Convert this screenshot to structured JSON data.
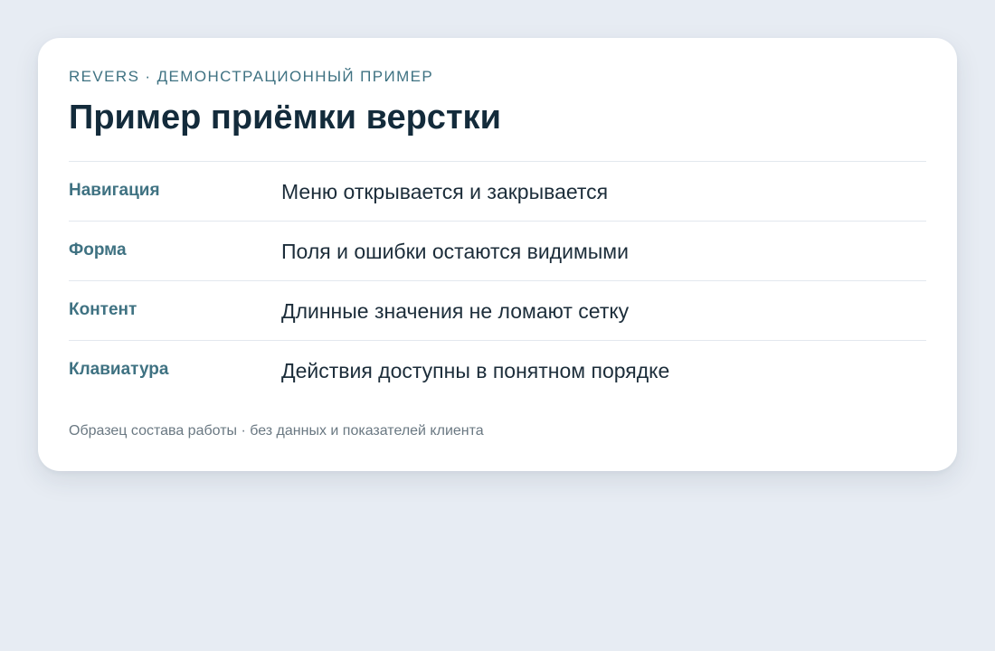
{
  "card": {
    "eyebrow": "REVERS · ДЕМОНСТРАЦИОННЫЙ ПРИМЕР",
    "title": "Пример приёмки верстки",
    "rows": [
      {
        "label": "Навигация",
        "value": "Меню открывается и закрывается"
      },
      {
        "label": "Форма",
        "value": "Поля и ошибки остаются видимыми"
      },
      {
        "label": "Контент",
        "value": "Длинные значения не ломают сетку"
      },
      {
        "label": "Клавиатура",
        "value": "Действия доступны в понятном порядке"
      }
    ],
    "footnote": "Образец состава работы · без данных и показателей клиента"
  },
  "colors": {
    "page_background": "#e7ecf3",
    "card_background": "#ffffff",
    "accent": "#3f7282",
    "heading": "#132b3b",
    "muted": "#6a7882"
  }
}
